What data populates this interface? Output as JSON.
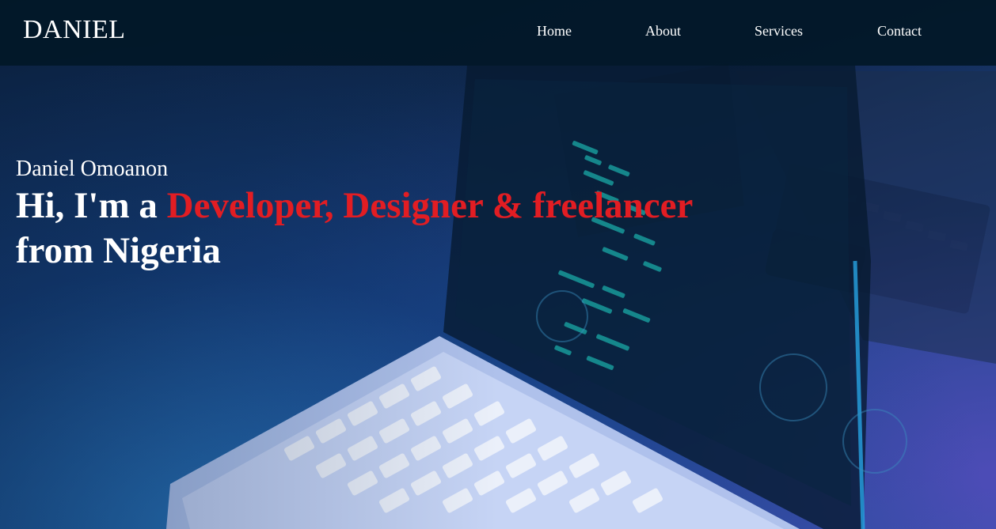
{
  "header": {
    "logo": "DANIEL",
    "nav": [
      {
        "label": "Home"
      },
      {
        "label": "About"
      },
      {
        "label": "Services"
      },
      {
        "label": "Contact"
      }
    ]
  },
  "hero": {
    "name": "Daniel Omoanon",
    "headline_prefix": "Hi, I'm a",
    "headline_highlight": "Developer, Designer & freelancer",
    "headline_suffix": "from Nigeria"
  },
  "colors": {
    "nav_background": "#021828",
    "accent": "#e21d23",
    "text": "#ffffff"
  }
}
